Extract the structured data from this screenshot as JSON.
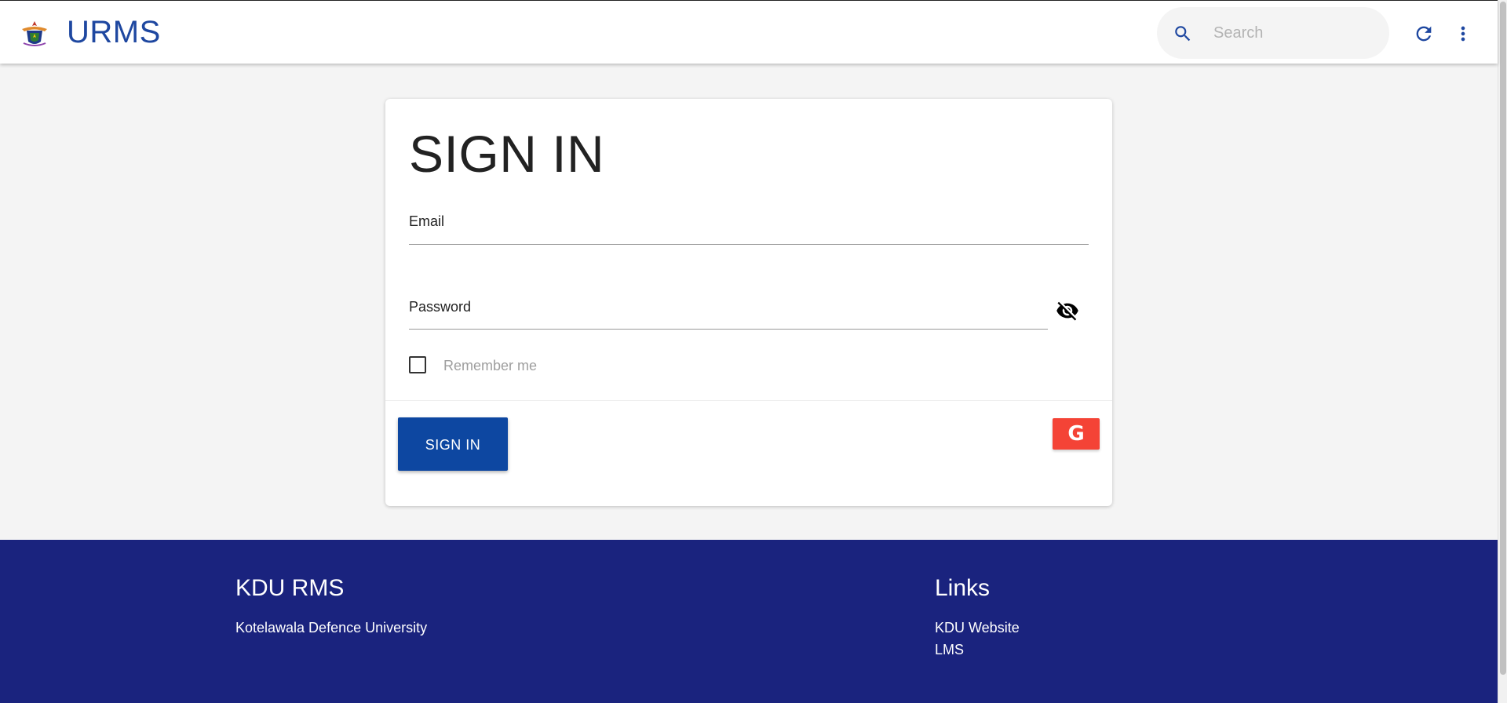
{
  "app": {
    "title": "URMS"
  },
  "search": {
    "placeholder": "Search",
    "value": ""
  },
  "icons": {
    "logo": "university-crest-logo",
    "search": "search-icon",
    "refresh": "refresh-icon",
    "more": "more-vert-icon",
    "visibility": "visibility-off-icon",
    "google": "google-icon"
  },
  "login": {
    "heading": "SIGN IN",
    "email_label": "Email",
    "email_value": "",
    "password_label": "Password",
    "password_value": "",
    "remember_label": "Remember me",
    "remember_checked": false,
    "submit_label": "SIGN IN",
    "google_glyph": "G"
  },
  "footer": {
    "left_heading": "KDU RMS",
    "left_text": "Kotelawala Defence University",
    "right_heading": "Links",
    "links": [
      "KDU Website",
      "LMS"
    ]
  },
  "colors": {
    "primary": "#0d47a1",
    "title_blue": "#1e47a0",
    "google_red": "#f44336",
    "footer_bg": "#1a237e",
    "page_bg": "#f4f4f4"
  }
}
